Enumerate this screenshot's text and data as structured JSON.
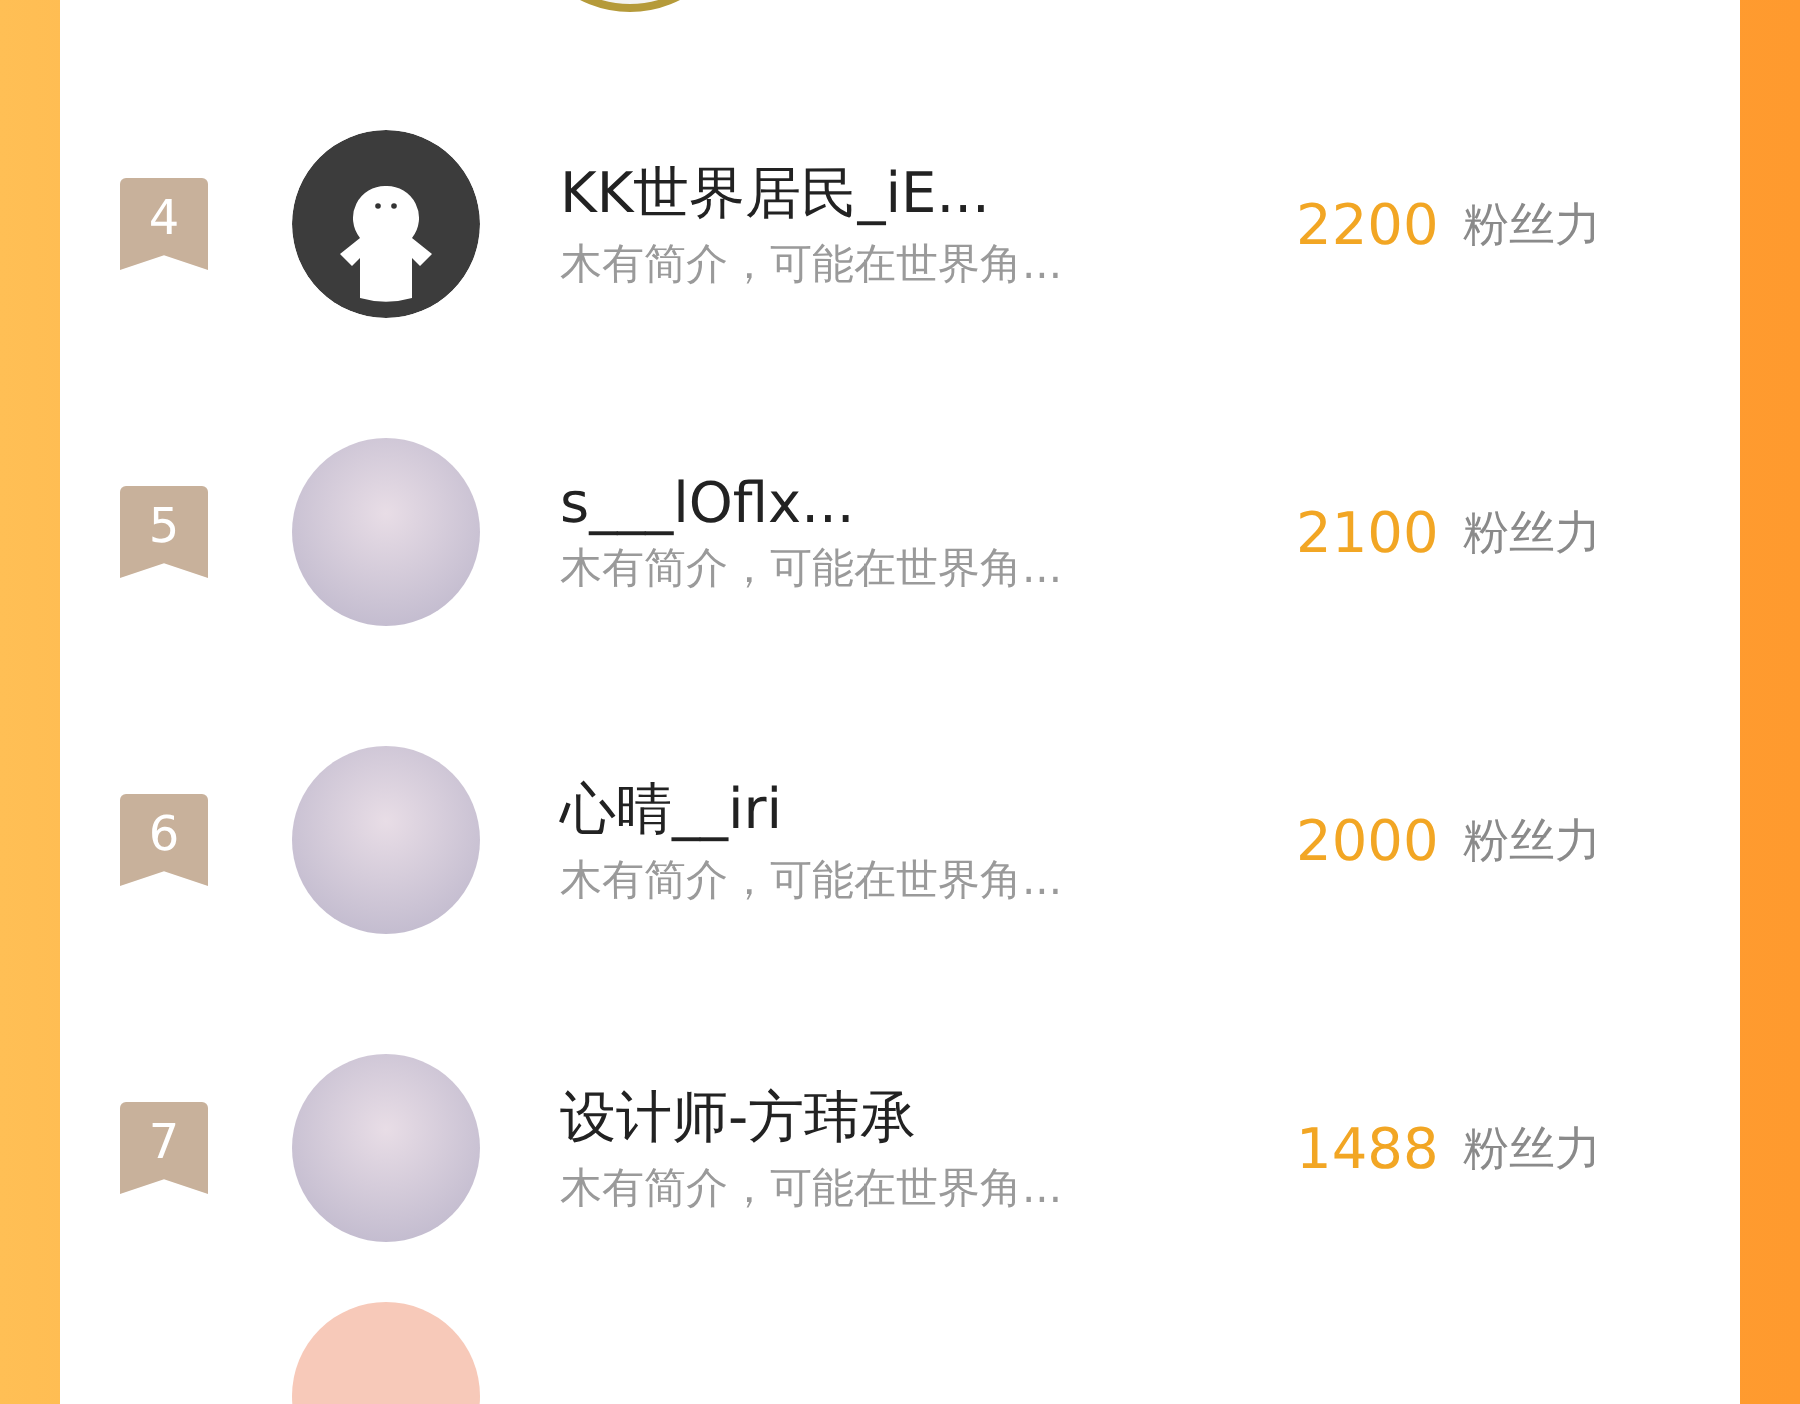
{
  "ranking": [
    {
      "rank": "4",
      "kind": "silhouette",
      "name": "KK世界居民_iE...",
      "bio": "木有简介，可能在世界角...",
      "score": "2200",
      "unit": "粉丝力"
    },
    {
      "rank": "5",
      "kind": "photo",
      "name": "s___lOflx...",
      "bio": "木有简介，可能在世界角...",
      "score": "2100",
      "unit": "粉丝力"
    },
    {
      "rank": "6",
      "kind": "photo",
      "name": "心晴__iri",
      "bio": "木有简介，可能在世界角...",
      "score": "2000",
      "unit": "粉丝力"
    },
    {
      "rank": "7",
      "kind": "photo",
      "name": "设计师-方玮承",
      "bio": "木有简介，可能在世界角...",
      "score": "1488",
      "unit": "粉丝力"
    }
  ]
}
